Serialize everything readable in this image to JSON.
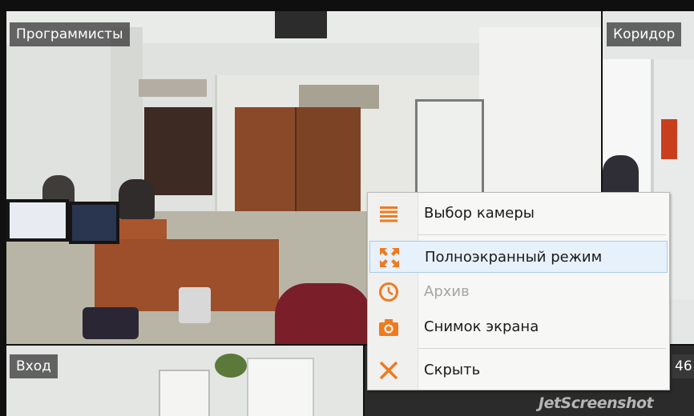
{
  "cameras": [
    {
      "label": "Программисты"
    },
    {
      "label": "Коридор"
    },
    {
      "label": "Вход"
    },
    {
      "label": "46"
    }
  ],
  "context_menu": {
    "items": [
      {
        "label": "Выбор камеры",
        "icon": "menu-lines-icon",
        "enabled": true
      },
      {
        "label": "Полноэкранный режим",
        "icon": "fullscreen-arrows-icon",
        "enabled": true,
        "highlighted": true
      },
      {
        "label": "Архив",
        "icon": "clock-icon",
        "enabled": false
      },
      {
        "label": "Снимок экрана",
        "icon": "camera-icon",
        "enabled": true
      },
      {
        "label": "Скрыть",
        "icon": "close-x-icon",
        "enabled": true
      }
    ],
    "accent_color": "#f07a1f"
  },
  "watermark": "JetScreenshot"
}
